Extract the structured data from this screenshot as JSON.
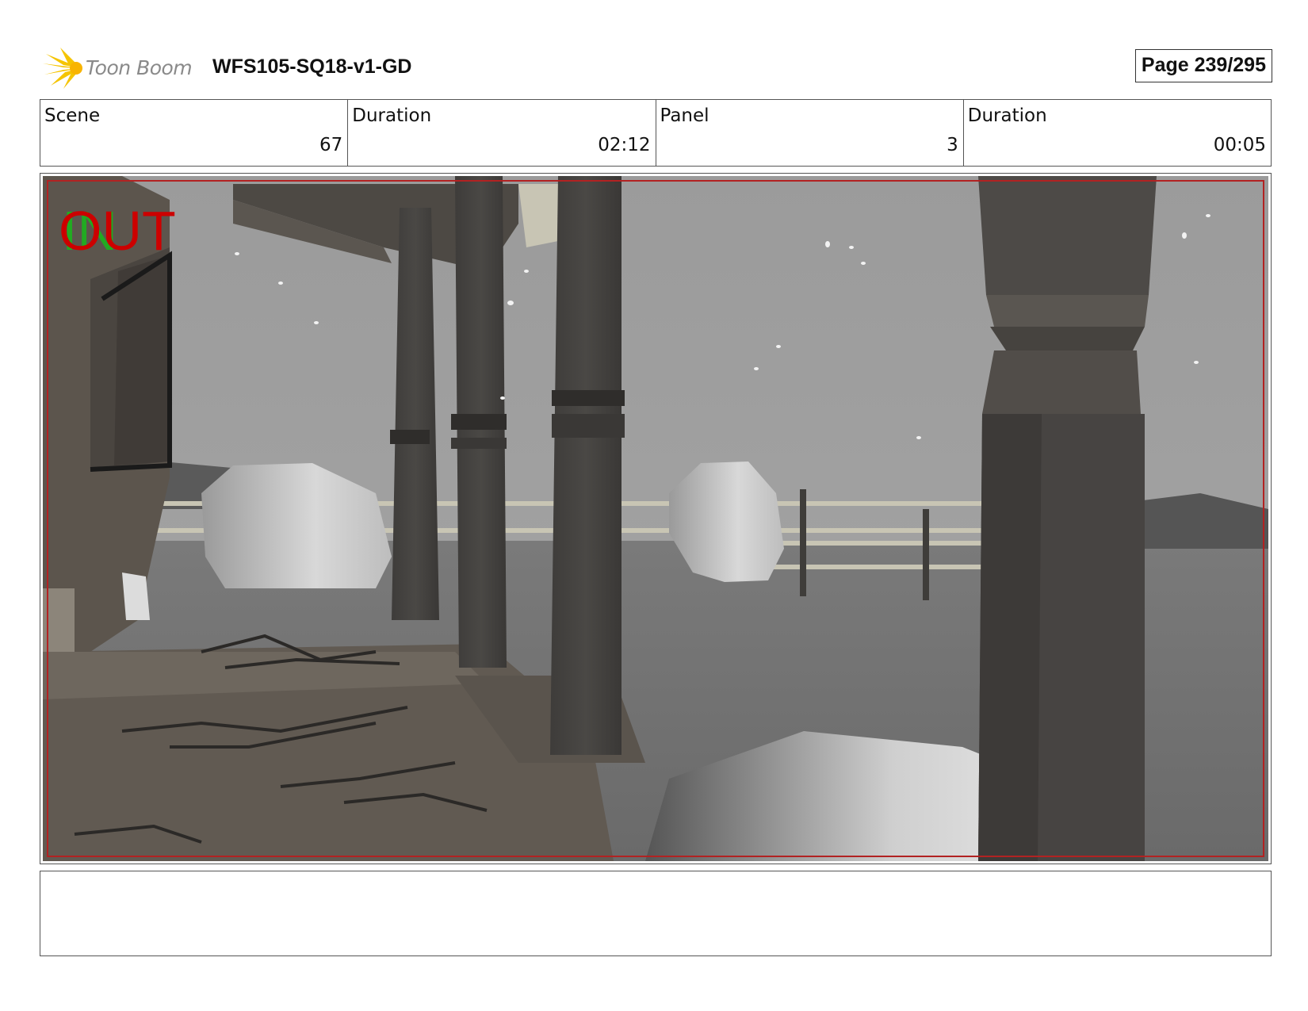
{
  "header": {
    "logo_text": "Toon Boom",
    "project_title": "WFS105-SQ18-v1-GD",
    "page_label": "Page 239/295"
  },
  "info": {
    "scene_label": "Scene",
    "scene_value": "67",
    "scene_duration_label": "Duration",
    "scene_duration_value": "02:12",
    "panel_label": "Panel",
    "panel_value": "3",
    "panel_duration_label": "Duration",
    "panel_duration_value": "00:05"
  },
  "panel": {
    "overlay_in": "IN",
    "overlay_out": "OUT"
  },
  "notes": {
    "text": ""
  },
  "colors": {
    "logo_yellow": "#f5c400",
    "safe_frame_red": "#b22222",
    "out_red": "#cc0000",
    "in_green": "#22aa22"
  }
}
